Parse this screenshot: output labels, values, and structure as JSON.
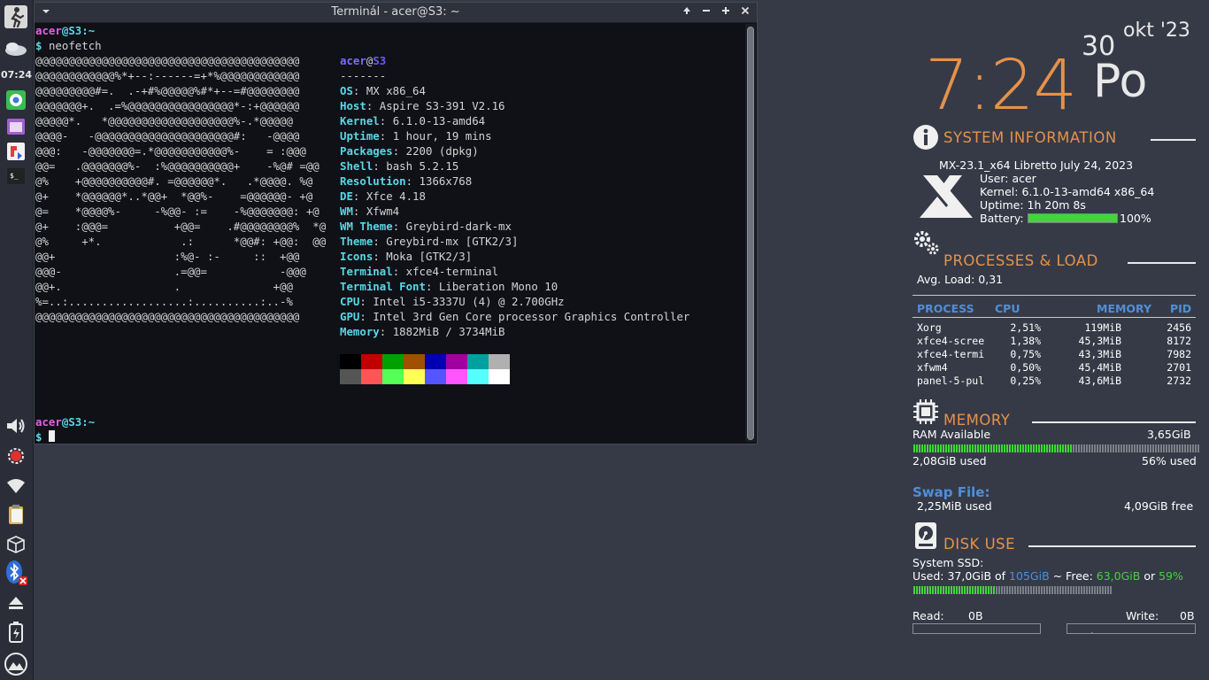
{
  "panel": {
    "clock": "07:24",
    "buttons": [
      "logout-icon",
      "weather-icon",
      "chrome-icon",
      "file-manager-icon",
      "software-center-icon",
      "terminal-icon",
      "volume-icon",
      "updater-icon",
      "wifi-icon",
      "clipboard-icon",
      "package-icon",
      "bluetooth-icon",
      "eject-icon",
      "battery-icon",
      "mx-logo-icon"
    ]
  },
  "terminal": {
    "title": "Terminál - acer@S3: ~",
    "prompt_user": "acer",
    "prompt_at": "@",
    "prompt_host": "S3",
    "prompt_path": ":~",
    "prompt_symbol": "$",
    "command": "neofetch",
    "ascii_art": [
      "@@@@@@@@@@@@@@@@@@@@@@@@@@@@@@@@@@@@@@@@",
      "@@@@@@@@@@@@%*+--:------=+*%@@@@@@@@@@@@",
      "@@@@@@@@@#=.  .-+#%@@@@@%#*+--=#@@@@@@@@",
      "@@@@@@@+.  .=%@@@@@@@@@@@@@@@@*-:+@@@@@@",
      "@@@@@*.   *@@@@@@@@@@@@@@@@@@@%-.*@@@@@",
      "@@@@-   -@@@@@@@@@@@@@@@@@@@@@#:   -@@@@",
      "@@@:   -@@@@@@@=.*@@@@@@@@@@@%-    = :@@@",
      "@@=   .@@@@@@@%-  :%@@@@@@@@@@+    -%@# =@@",
      "@%    +@@@@@@@@@@#. =@@@@@@*.   .*@@@@. %@",
      "@+    *@@@@@@*..*@@+  *@@%-    =@@@@@@- +@",
      "@=    *@@@@%-     -%@@- :=    -%@@@@@@@: +@",
      "@+    :@@@=          +@@=    .#@@@@@@@@%  *@",
      "@%     +*.            .:      *@@#: +@@:  @@",
      "@@+                  :%@- :-     ::  +@@",
      "@@@-                 .=@@=           -@@@",
      "@@+.                 .              +@@",
      "%=..:..................:..........:..-%",
      "@@@@@@@@@@@@@@@@@@@@@@@@@@@@@@@@@@@@@@@@"
    ],
    "info_user": "acer",
    "info_at": "@",
    "info_host": "S3",
    "separator": "-------",
    "info": [
      {
        "key": "OS",
        "value": "MX x86_64"
      },
      {
        "key": "Host",
        "value": "Aspire S3-391 V2.16"
      },
      {
        "key": "Kernel",
        "value": "6.1.0-13-amd64"
      },
      {
        "key": "Uptime",
        "value": "1 hour, 19 mins"
      },
      {
        "key": "Packages",
        "value": "2200 (dpkg)"
      },
      {
        "key": "Shell",
        "value": "bash 5.2.15"
      },
      {
        "key": "Resolution",
        "value": "1366x768"
      },
      {
        "key": "DE",
        "value": "Xfce 4.18"
      },
      {
        "key": "WM",
        "value": "Xfwm4"
      },
      {
        "key": "WM Theme",
        "value": "Greybird-dark-mx"
      },
      {
        "key": "Theme",
        "value": "Greybird-mx [GTK2/3]"
      },
      {
        "key": "Icons",
        "value": "Moka [GTK2/3]"
      },
      {
        "key": "Terminal",
        "value": "xfce4-terminal"
      },
      {
        "key": "Terminal Font",
        "value": "Liberation Mono 10"
      },
      {
        "key": "CPU",
        "value": "Intel i5-3337U (4) @ 2.700GHz"
      },
      {
        "key": "GPU",
        "value": "Intel 3rd Gen Core processor Graphics Controller"
      },
      {
        "key": "Memory",
        "value": "1882MiB / 3734MiB"
      }
    ],
    "palette_dark": [
      "#000000",
      "#c00000",
      "#00a000",
      "#a05000",
      "#0000b0",
      "#a000a0",
      "#00a0a0",
      "#b0b0b0"
    ],
    "palette_bright": [
      "#555555",
      "#ff5555",
      "#55ff55",
      "#ffff55",
      "#5555ff",
      "#ff55ff",
      "#55ffff",
      "#ffffff"
    ]
  },
  "conky": {
    "time": "7:24",
    "day": "30",
    "weekday": "Po",
    "month_year": "okt '23",
    "system": {
      "title": "SYSTEM INFORMATION",
      "distro": "MX-23.1_x64 Libretto July 24, 2023",
      "user": "User: acer",
      "kernel": "Kernel: 6.1.0-13-amd64 x86_64",
      "uptime": "Uptime: 1h 20m 8s",
      "battery_label": "Battery:",
      "battery_value": "100%",
      "battery_fraction": 1.0
    },
    "processes": {
      "title": "PROCESSES & LOAD",
      "avg_load": "Avg. Load: 0,31",
      "headers": {
        "process": "PROCESS",
        "cpu": "CPU",
        "memory": "MEMORY",
        "pid": "PID"
      },
      "rows": [
        {
          "name": "Xorg",
          "cpu": "2,51%",
          "mem": "119MiB",
          "pid": "2456"
        },
        {
          "name": "xfce4-scree",
          "cpu": "1,38%",
          "mem": "45,3MiB",
          "pid": "8172"
        },
        {
          "name": "xfce4-termi",
          "cpu": "0,75%",
          "mem": "43,3MiB",
          "pid": "7982"
        },
        {
          "name": "xfwm4",
          "cpu": "0,50%",
          "mem": "45,4MiB",
          "pid": "2701"
        },
        {
          "name": "panel-5-pul",
          "cpu": "0,25%",
          "mem": "43,6MiB",
          "pid": "2732"
        }
      ]
    },
    "memory": {
      "title": "MEMORY",
      "ram_label": "RAM Available",
      "ram_value": "3,65GiB",
      "used": "2,08GiB used",
      "percent": "56% used",
      "used_fraction": 0.56,
      "swap_title": "Swap File:",
      "swap_used": "2,25MiB used",
      "swap_free": "4,09GiB free"
    },
    "disk": {
      "title": "DISK USE",
      "device": "System SSD:",
      "used_prefix": "Used: 37,0GiB of ",
      "total": "105GiB",
      "free_prefix": " ~ Free: ",
      "free": "63,0GiB",
      "or": " or ",
      "free_pct": "59%",
      "used_fraction": 0.41,
      "read_label": "Read:",
      "read_value": "0B",
      "write_label": "Write:",
      "write_value": "0B"
    },
    "colors": {
      "accent": "#e5924a",
      "green": "#43d43b",
      "blue": "#4f8fd9"
    }
  }
}
